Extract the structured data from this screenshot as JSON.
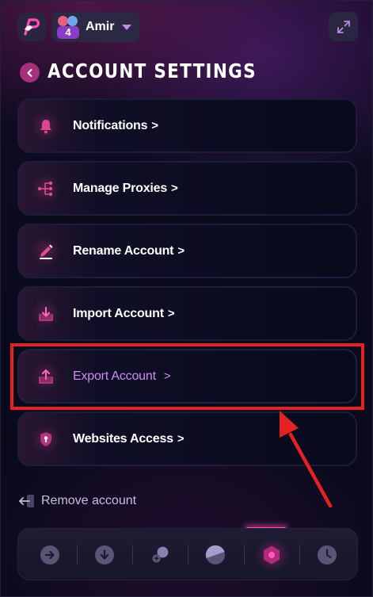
{
  "header": {
    "account_name": "Amir",
    "account_count": "4",
    "icons": {
      "logo": "app-logo",
      "caret": "chevron-down-icon",
      "expand": "expand-icon"
    }
  },
  "title": {
    "text": "ACCOUNT SETTINGS",
    "back_icon": "chevron-left-icon"
  },
  "menu": {
    "items": [
      {
        "label": "Notifications",
        "icon": "bell-icon"
      },
      {
        "label": "Manage Proxies",
        "icon": "proxy-tree-icon"
      },
      {
        "label": "Rename Account",
        "icon": "rename-pencil-icon"
      },
      {
        "label": "Import Account",
        "icon": "import-icon"
      },
      {
        "label": "Export Account",
        "icon": "export-icon",
        "selected": true
      },
      {
        "label": "Websites Access",
        "icon": "shield-keyhole-icon"
      }
    ],
    "chevron": ">"
  },
  "remove_account": {
    "label": "Remove account",
    "icon": "logout-icon"
  },
  "bottom_bar": {
    "buttons": [
      "send-icon",
      "receive-icon",
      "swap-icon",
      "network-icon",
      "hexagon-icon",
      "history-icon"
    ],
    "active_index": 4
  },
  "colors": {
    "accent_pink": "#ff4fb3",
    "accent_purple": "#c98ef0",
    "annotation_red": "#e52222"
  }
}
